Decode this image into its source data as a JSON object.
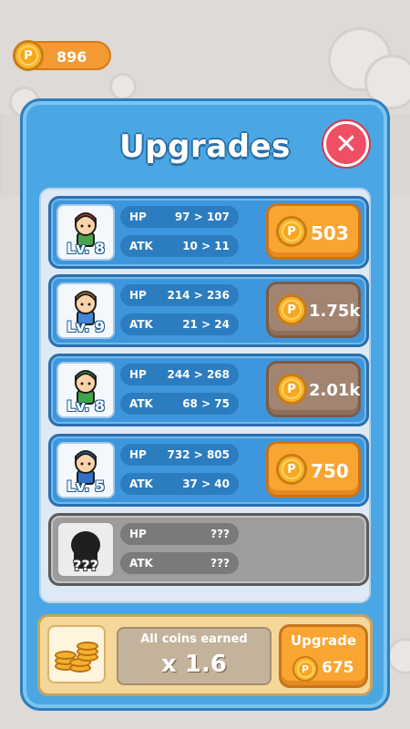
{
  "coins": {
    "icon": "coin-icon",
    "value": "896"
  },
  "panel": {
    "title": "Upgrades",
    "close_icon": "close-icon"
  },
  "heroes": [
    {
      "level": "Lv. 8",
      "hp": "97 > 107",
      "atk": "10 > 11",
      "price": "503",
      "affordable": true,
      "hair": "#e2463b",
      "shirt": "#4aa34b"
    },
    {
      "level": "Lv. 9",
      "hp": "214 > 236",
      "atk": "21 > 24",
      "price": "1.75k",
      "affordable": false,
      "hair": "#f39a2a",
      "shirt": "#3f86d6"
    },
    {
      "level": "Lv. 8",
      "hp": "244 > 268",
      "atk": "68 > 75",
      "price": "2.01k",
      "affordable": false,
      "hair": "#3ea64a",
      "shirt": "#3ea64a"
    },
    {
      "level": "Lv. 5",
      "hp": "732 > 805",
      "atk": "37 > 40",
      "price": "750",
      "affordable": true,
      "hair": "#2f6fc7",
      "shirt": "#2f6fc7"
    }
  ],
  "locked": {
    "level": "???",
    "hp": "???",
    "atk": "???"
  },
  "stat_labels": {
    "hp": "HP",
    "atk": "ATK"
  },
  "bonus": {
    "label": "All coins earned",
    "multiplier": "x 1.6",
    "button_label": "Upgrade",
    "price": "675"
  },
  "colors": {
    "panel": "#4aa7e3",
    "button": "#f9a532",
    "disabled_button": "#a38470",
    "close": "#ef4f64"
  }
}
